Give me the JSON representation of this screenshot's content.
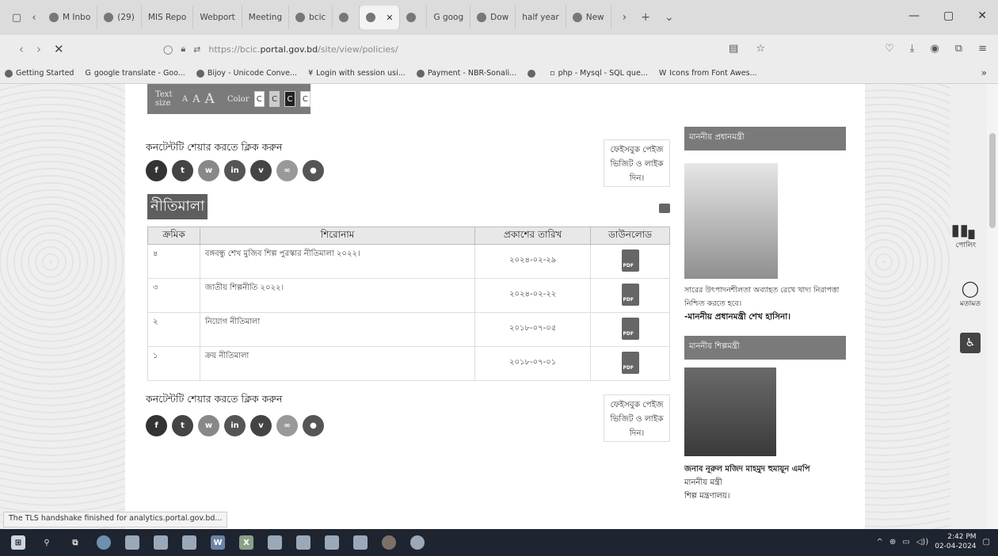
{
  "browser": {
    "tabs": [
      {
        "label": "M Inbo",
        "active": false
      },
      {
        "label": "(29)",
        "active": false
      },
      {
        "label": "MIS Repo",
        "active": false
      },
      {
        "label": "Webport",
        "active": false
      },
      {
        "label": "Meeting",
        "active": false
      },
      {
        "label": "bcic",
        "active": false
      },
      {
        "label": "",
        "active": false
      },
      {
        "label": "",
        "active": true
      },
      {
        "label": "",
        "active": false
      },
      {
        "label": "G goog",
        "active": false
      },
      {
        "label": "Dow",
        "active": false
      },
      {
        "label": "half year",
        "active": false
      },
      {
        "label": "New",
        "active": false
      }
    ],
    "url_host": "https://bcic.",
    "url_domain": "portal.gov.bd",
    "url_path": "/site/view/policies/",
    "bookmarks": [
      "Getting Started",
      "google translate - Goo...",
      "Bijoy - Unicode Conve...",
      "Login with session usi...",
      "Payment - NBR-Sonali...",
      "",
      "php - Mysql - SQL que...",
      "Icons from Font Awes..."
    ],
    "status_text": "The TLS handshake finished for analytics.portal.gov.bd..."
  },
  "page": {
    "access": {
      "text_size_label": "Text size",
      "size_small": "A",
      "size_medium": "A",
      "size_large": "A",
      "color_label": "Color",
      "color_options": [
        "C",
        "C",
        "C",
        "C"
      ]
    },
    "share_title": "কনটেন্টটি শেয়ার করতে ক্লিক করুন",
    "fb_box_text": "ফেইসবুক পেইজ ভিজিট ও লাইক দিন।",
    "title": "নীতিমালা",
    "table": {
      "headers": [
        "ক্রমিক",
        "শিরোনাম",
        "প্রকাশের তারিখ",
        "ডাউনলোড"
      ],
      "rows": [
        {
          "serial": "৪",
          "title": "বঙ্গবন্ধু শেখ মুজিব শিল্প পুরস্কার নীতিমালা ২০২২।",
          "date": "২০২৪-০২-২৯"
        },
        {
          "serial": "৩",
          "title": "জাতীয় শিল্পনীতি ২০২২।",
          "date": "২০২৪-০২-২২"
        },
        {
          "serial": "২",
          "title": "নিয়োগ নীতিমালা",
          "date": "২০১৮-০৭-০৫"
        },
        {
          "serial": "১",
          "title": "ক্রয় নীতিমালা",
          "date": "২০১৮-০৭-০১"
        }
      ]
    },
    "sidebar": {
      "pm_heading": "মাননীয় প্রধানমন্ত্রী",
      "pm_quote": "সারের উৎপাদনশীলতা অব্যাহত রেখে খাদ্য নিরাপত্তা নিশ্চিত করতে হবে।",
      "pm_signature": "-মাননীয় প্রধানমন্ত্রী শেখ হাসিনা।",
      "minister_heading": "মাননীয় শিল্পমন্ত্রী",
      "minister_name": "জনাব নূরুল মজিদ মাহমুদ হুমায়ূন এমপি",
      "minister_role": "মাননীয় মন্ত্রী",
      "minister_ministry": "শিল্প মন্ত্রণালয়।"
    },
    "widgets": {
      "poll_label": "পোলিং",
      "feedback_label": "মতামত"
    }
  },
  "taskbar": {
    "time": "2:42 PM",
    "date": "02-04-2024"
  }
}
